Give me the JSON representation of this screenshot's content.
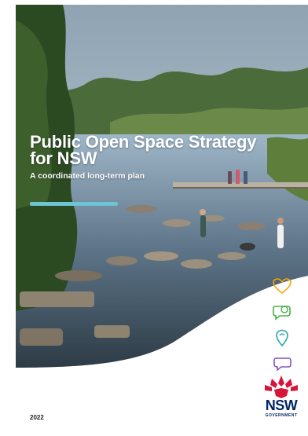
{
  "cover": {
    "title": "Public Open Space Strategy for NSW",
    "subtitle": "A coordinated long-term plan",
    "year": "2022",
    "accent_color": "#6cc4d4"
  },
  "icons": [
    {
      "name": "heart-icon",
      "color": "#f5a800"
    },
    {
      "name": "speech-bubble-green-icon",
      "color": "#48b048"
    },
    {
      "name": "location-pin-icon",
      "color": "#2aa6a6"
    },
    {
      "name": "speech-bubble-purple-icon",
      "color": "#8455c8"
    }
  ],
  "logo": {
    "wordmark": "NSW",
    "tagline": "GOVERNMENT",
    "brand_color": "#002664",
    "waratah_color": "#d7153a"
  }
}
